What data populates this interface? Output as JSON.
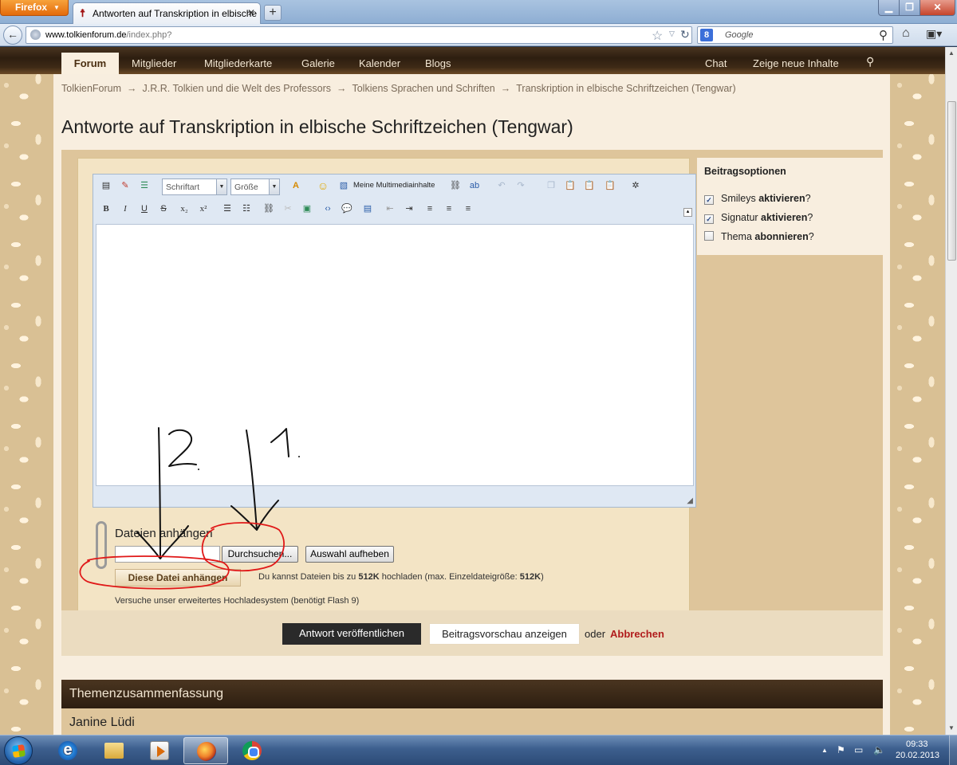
{
  "browser": {
    "menu_button": "Firefox",
    "tab_title": "Antworten auf Transkription in elbische ...",
    "url_domain": "www.tolkienforum.de",
    "url_path": "/index.php?",
    "search_placeholder": "Google"
  },
  "site_nav": {
    "active": "Forum",
    "items": [
      "Mitglieder",
      "Mitgliederkarte",
      "Galerie",
      "Kalender",
      "Blogs"
    ],
    "right_items": [
      "Chat",
      "Zeige neue Inhalte"
    ]
  },
  "breadcrumb": [
    "TolkienForum",
    "J.R.R. Tolkien und die Welt des Professors",
    "Tolkiens Sprachen und Schriften",
    "Transkription in elbische Schriftzeichen (Tengwar)"
  ],
  "breadcrumb_separator": "→",
  "page_title": "Antworte auf Transkription in elbische Schriftzeichen (Tengwar)",
  "editor": {
    "font_select": "Schriftart",
    "size_select": "Größe",
    "media_label": "Meine Multimediainhalte"
  },
  "attachments": {
    "title": "Dateien anhängen",
    "browse_button": "Durchsuchen...",
    "clear_button": "Auswahl aufheben",
    "attach_button": "Diese Datei anhängen",
    "info_prefix": "Du kannst Dateien bis zu ",
    "info_limit": "512K",
    "info_middle": " hochladen (max. Einzeldateigröße: ",
    "info_max": "512K",
    "info_suffix": ")",
    "flash_hint": "Versuche unser erweitertes Hochladesystem (benötigt Flash 9)"
  },
  "options": {
    "title": "Beitragsoptionen",
    "items": [
      {
        "pre": "Smileys ",
        "bold": "aktivieren",
        "post": "?",
        "checked": true
      },
      {
        "pre": "Signatur ",
        "bold": "aktivieren",
        "post": "?",
        "checked": true
      },
      {
        "pre": "Thema ",
        "bold": "abonnieren",
        "post": "?",
        "checked": false
      }
    ]
  },
  "submit": {
    "post_button": "Antwort veröffentlichen",
    "preview_button": "Beitragsvorschau anzeigen",
    "or_text": "oder",
    "cancel_link": "Abbrechen"
  },
  "summary": {
    "header": "Themenzusammenfassung",
    "first_user": "Janine Lüdi"
  },
  "annotations": {
    "label_2": "2.",
    "label_1": "1."
  },
  "taskbar": {
    "time": "09:33",
    "date": "20.02.2013"
  },
  "colors": {
    "annotation_red": "#e01818",
    "nav_brown": "#2d1e10",
    "cancel_red": "#b11c1c"
  }
}
